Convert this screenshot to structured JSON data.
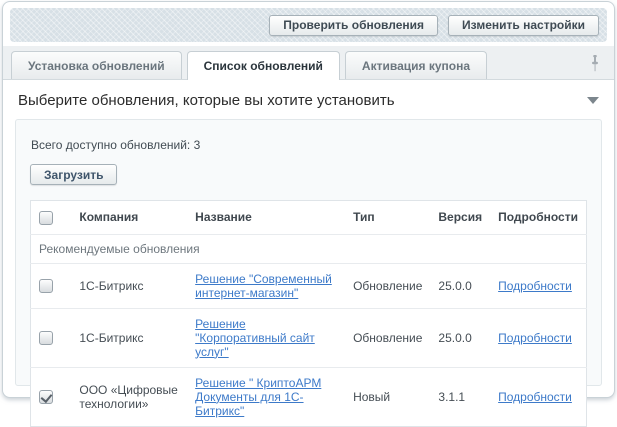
{
  "colors": {
    "link": "#3d7ac9",
    "toolbar-bg": "#d7e0e6",
    "btn-text": "#3f4b54",
    "panel-bg": "#f8fafb"
  },
  "toolbar": {
    "check_updates_label": "Проверить обновления",
    "edit_settings_label": "Изменить настройки"
  },
  "tabs": [
    {
      "label": "Установка обновлений",
      "active": false
    },
    {
      "label": "Список обновлений",
      "active": true
    },
    {
      "label": "Активация купона",
      "active": false
    }
  ],
  "icons": {
    "pin": "pin-icon",
    "dropdown": "chevron-down-icon"
  },
  "section": {
    "title": "Выберите обновления, которые вы хотите установить",
    "available_text": "Всего доступно обновлений: 3",
    "load_button_label": "Загрузить"
  },
  "table": {
    "headers": {
      "company": "Компания",
      "name": "Название",
      "type": "Тип",
      "version": "Версия",
      "details": "Подробности"
    },
    "group_label": "Рекомендуемые обновления",
    "rows": [
      {
        "checked": false,
        "company": "1С-Битрикс",
        "name": "Решение \"Современный интернет-магазин\"",
        "type": "Обновление",
        "version": "25.0.0",
        "details": "Подробности"
      },
      {
        "checked": false,
        "company": "1С-Битрикс",
        "name": "Решение \"Корпоративный сайт услуг\"",
        "type": "Обновление",
        "version": "25.0.0",
        "details": "Подробности"
      },
      {
        "checked": true,
        "company": "ООО «Цифровые технологии»",
        "name": "Решение \" КриптоАРМ Документы для 1С-Битрикс\"",
        "type": "Новый",
        "version": "3.1.1",
        "details": "Подробности"
      }
    ]
  }
}
